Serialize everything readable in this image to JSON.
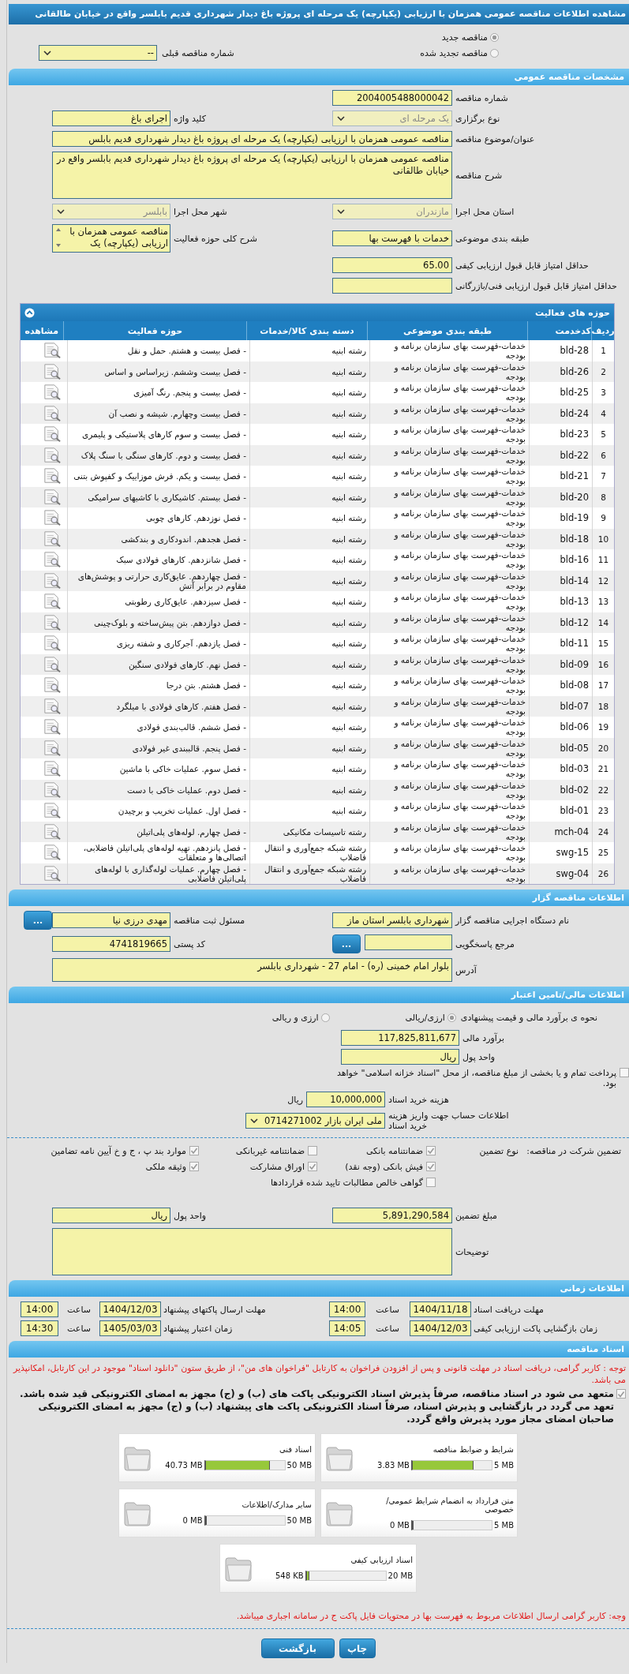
{
  "title": "مشاهده اطلاعات مناقصه عمومی همزمان با ارزیابی (یکپارچه) یک مرحله ای پروژه باغ دیدار شهرداری قدیم بابلسر واقع در خیابان طالقانی",
  "tender_status": [
    {
      "label": "مناقصه جدید",
      "selected": true
    },
    {
      "label": "مناقصه تجدید شده",
      "selected": false
    }
  ],
  "previous_tender": {
    "label": "شماره مناقصه قبلی",
    "value": "--",
    "disabled": false
  },
  "general": {
    "header": "مشخصات مناقصه عمومی",
    "rows": [
      [
        {
          "label": "شماره مناقصه",
          "value": "2004005488000042",
          "kind": "input"
        }
      ],
      [
        {
          "label": "نوع برگزاری",
          "value": "یک مرحله ای",
          "kind": "select",
          "disabled": true
        },
        {
          "label": "کلید واژه",
          "value": "اجرای باغ",
          "kind": "input"
        }
      ],
      [
        {
          "label": "عنوان/موضوع مناقصه",
          "value": "مناقصه عمومی همزمان با ارزیابی (یکپارچه) یک مرحله ای پروژه باغ دیدار شهرداری قدیم بابلس",
          "kind": "wide_input"
        }
      ],
      [
        {
          "label": "شرح مناقصه",
          "value": "مناقصه عمومی همزمان با ارزیابی (یکپارچه) یک مرحله ای پروژه باغ دیدار شهرداری قدیم بابلسر واقع در خیابان طالقانی",
          "kind": "textarea"
        }
      ],
      [
        {
          "label": "استان محل اجرا",
          "value": "مازندران",
          "kind": "select",
          "disabled": true
        },
        {
          "label": "شهر محل اجرا",
          "value": "بابلسر",
          "kind": "select",
          "disabled": true
        }
      ],
      [
        {
          "label": "طبقه بندی موضوعی",
          "value": "خدمات با فهرست بها",
          "kind": "input"
        },
        {
          "label": "شرح کلی حوزه فعالیت",
          "value": "مناقصه عمومی همزمان با ارزیابی (یکپارچه) یک",
          "kind": "listbox"
        }
      ],
      [
        {
          "label": "حداقل امتیاز قابل قبول ارزیابی کیفی",
          "value": "65.00",
          "kind": "input"
        }
      ],
      [
        {
          "label": "حداقل امتیاز قابل قبول ارزیابی فنی/بازرگانی",
          "kind": "input"
        }
      ]
    ]
  },
  "activities": {
    "header": "حوزه های فعالیت",
    "columns": [
      "ردیف",
      "کدخدمت",
      "طبقه بندی موضوعی",
      "دسته بندی کالا/خدمات",
      "حوزه فعالیت",
      "مشاهده"
    ],
    "rows": [
      {
        "index": "1",
        "code": "bld-28",
        "category": "خدمات-فهرست بهای سازمان برنامه و بودجه",
        "group": "رشته ابنیه",
        "activity": "- فصل بیست و هشتم. حمل و نقل"
      },
      {
        "index": "2",
        "code": "bld-26",
        "category": "خدمات-فهرست بهای سازمان برنامه و بودجه",
        "group": "رشته ابنیه",
        "activity": "- فصل بیست وششم. زیراساس و اساس"
      },
      {
        "index": "3",
        "code": "bld-25",
        "category": "خدمات-فهرست بهای سازمان برنامه و بودجه",
        "group": "رشته ابنیه",
        "activity": "- فصل بیست و پنجم. رنگ آمیزی"
      },
      {
        "index": "4",
        "code": "bld-24",
        "category": "خدمات-فهرست بهای سازمان برنامه و بودجه",
        "group": "رشته ابنیه",
        "activity": "- فصل بیست وچهارم. شیشه و نصب آن"
      },
      {
        "index": "5",
        "code": "bld-23",
        "category": "خدمات-فهرست بهای سازمان برنامه و بودجه",
        "group": "رشته ابنیه",
        "activity": "- فصل بیست و سوم کارهای پلاستیکی و پلیمری"
      },
      {
        "index": "6",
        "code": "bld-22",
        "category": "خدمات-فهرست بهای سازمان برنامه و بودجه",
        "group": "رشته ابنیه",
        "activity": "- فصل بیست و دوم. کارهای سنگی با سنگ پلاک"
      },
      {
        "index": "7",
        "code": "bld-21",
        "category": "خدمات-فهرست بهای سازمان برنامه و بودجه",
        "group": "رشته ابنیه",
        "activity": "- فصل بیست و یکم. فرش موزاییک و کفپوش بتنی"
      },
      {
        "index": "8",
        "code": "bld-20",
        "category": "خدمات-فهرست بهای سازمان برنامه و بودجه",
        "group": "رشته ابنیه",
        "activity": "- فصل بیستم. کاشیکاری با کاشیهای سرامیکی"
      },
      {
        "index": "9",
        "code": "bld-19",
        "category": "خدمات-فهرست بهای سازمان برنامه و بودجه",
        "group": "رشته ابنیه",
        "activity": "- فصل نوزدهم. کارهای چوبی"
      },
      {
        "index": "10",
        "code": "bld-18",
        "category": "خدمات-فهرست بهای سازمان برنامه و بودجه",
        "group": "رشته ابنیه",
        "activity": "- فصل هجدهم. اندودکاری و بندکشی"
      },
      {
        "index": "11",
        "code": "bld-16",
        "category": "خدمات-فهرست بهای سازمان برنامه و بودجه",
        "group": "رشته ابنیه",
        "activity": "- فصل شانزدهم. کارهای فولادی سبک"
      },
      {
        "index": "12",
        "code": "bld-14",
        "category": "خدمات-فهرست بهای سازمان برنامه و بودجه",
        "group": "رشته ابنیه",
        "activity": "- فصل چهاردهم. عایق‌کاری حرارتی و پوشش‌های مقاوم در برابر آتش"
      },
      {
        "index": "13",
        "code": "bld-13",
        "category": "خدمات-فهرست بهای سازمان برنامه و بودجه",
        "group": "رشته ابنیه",
        "activity": "- فصل سیزدهم. عایق‌کاری رطوبتی"
      },
      {
        "index": "14",
        "code": "bld-12",
        "category": "خدمات-فهرست بهای سازمان برنامه و بودجه",
        "group": "رشته ابنیه",
        "activity": "- فصل دوازدهم. بتن پیش‌ساخته و بلوک‌چینی"
      },
      {
        "index": "15",
        "code": "bld-11",
        "category": "خدمات-فهرست بهای سازمان برنامه و بودجه",
        "group": "رشته ابنیه",
        "activity": "- فصل یازدهم. آجرکاری و شفته ریزی"
      },
      {
        "index": "16",
        "code": "bld-09",
        "category": "خدمات-فهرست بهای سازمان برنامه و بودجه",
        "group": "رشته ابنیه",
        "activity": "- فصل نهم. کارهای فولادی سنگین"
      },
      {
        "index": "17",
        "code": "bld-08",
        "category": "خدمات-فهرست بهای سازمان برنامه و بودجه",
        "group": "رشته ابنیه",
        "activity": "- فصل هشتم. بتن درجا"
      },
      {
        "index": "18",
        "code": "bld-07",
        "category": "خدمات-فهرست بهای سازمان برنامه و بودجه",
        "group": "رشته ابنیه",
        "activity": "- فصل هفتم. کارهای فولادی با میلگرد"
      },
      {
        "index": "19",
        "code": "bld-06",
        "category": "خدمات-فهرست بهای سازمان برنامه و بودجه",
        "group": "رشته ابنیه",
        "activity": "- فصل ششم. قالب‌بندی فولادی"
      },
      {
        "index": "20",
        "code": "bld-05",
        "category": "خدمات-فهرست بهای سازمان برنامه و بودجه",
        "group": "رشته ابنیه",
        "activity": "- فصل پنجم. قالببندی غیر فولادی"
      },
      {
        "index": "21",
        "code": "bld-03",
        "category": "خدمات-فهرست بهای سازمان برنامه و بودجه",
        "group": "رشته ابنیه",
        "activity": "- فصل سوم. عملیات خاکی با ماشین"
      },
      {
        "index": "22",
        "code": "bld-02",
        "category": "خدمات-فهرست بهای سازمان برنامه و بودجه",
        "group": "رشته ابنیه",
        "activity": "- فصل دوم. عملیات خاکی با دست"
      },
      {
        "index": "23",
        "code": "bld-01",
        "category": "خدمات-فهرست بهای سازمان برنامه و بودجه",
        "group": "رشته ابنیه",
        "activity": "- فصل اول. عملیات تخریب و برچیدن"
      },
      {
        "index": "24",
        "code": "mch-04",
        "category": "خدمات-فهرست بهای سازمان برنامه و بودجه",
        "group": "رشته تاسیسات مکانیکی",
        "activity": "- فصل چهارم. لوله‌های پلی‌اتیلن"
      },
      {
        "index": "25",
        "code": "swg-15",
        "category": "خدمات-فهرست بهای سازمان برنامه و بودجه",
        "group": "رشته شبکه جمع‌آوری و انتقال فاضلاب",
        "activity": "- فصل پانزدهم. تهیه لوله‌های پلی‌اتیلن فاضلابی، اتصالی‌ها و متعلقات"
      },
      {
        "index": "26",
        "code": "swg-04",
        "category": "خدمات-فهرست بهای سازمان برنامه و بودجه",
        "group": "رشته شبکه جمع‌آوری و انتقال فاضلاب",
        "activity": "- فصل چهارم. عملیات لوله‌گذاری با لوله‌های پلی‌اتیلن فاضلابی"
      }
    ]
  },
  "tenderer": {
    "header": "اطلاعات مناقصه گزار",
    "rows": [
      [
        {
          "label": "نام دستگاه اجرایی مناقصه گزار",
          "value": "شهرداری بابلسر استان ماز",
          "kind": "input"
        },
        {
          "label": "مسئول ثبت مناقصه",
          "value": "مهدی درزی نیا",
          "kind": "input",
          "button": "..."
        }
      ],
      [
        {
          "label": "مرجع پاسخگویی",
          "kind": "input",
          "button": "..."
        },
        {
          "label": "کد پستی",
          "value": "4741819665",
          "kind": "input"
        }
      ],
      [
        {
          "label": "آدرس",
          "value": "بلوار امام خمینی (ره) - امام 27 - شهرداری بابلسر",
          "kind": "textarea"
        }
      ]
    ]
  },
  "finance": {
    "header": "اطلاعات مالی/تامین اعتبار",
    "estimate_method": {
      "label": "نحوه ی برآورد مالی و قیمت پیشنهادی",
      "options": [
        {
          "label": "ارزی/ریالی",
          "selected": true
        },
        {
          "label": "ارزی و ریالی",
          "selected": false
        }
      ]
    },
    "estimate": {
      "label": "برآورد مالی",
      "value": "117,825,811,677"
    },
    "currency": {
      "label": "واحد پول",
      "value": "ریال"
    },
    "treasury": {
      "label": "پرداخت تمام و یا بخشی از مبلغ مناقصه، از محل \"اسناد خزانه اسلامی\" خواهد بود.",
      "checked": false
    },
    "document_fee": {
      "label": "هزینه خرید اسناد",
      "value": "10,000,000",
      "unit": "ریال"
    },
    "account": {
      "label": "اطلاعات حساب جهت واریز هزینه خرید اسناد",
      "value": "ملی ایران بازار 0714271002"
    }
  },
  "guarantee": {
    "label": "تضمین شرکت در مناقصه:",
    "type_label": "نوع تضمین",
    "options": [
      {
        "label": "ضمانتنامه بانکی",
        "checked": true
      },
      {
        "label": "ضمانتنامه غیربانکی",
        "checked": false
      },
      {
        "label": "موارد بند پ ، ج و خ آیین نامه تضامین",
        "checked": true
      },
      {
        "label": "فیش بانکی (وجه نقد)",
        "checked": true
      },
      {
        "label": "اوراق مشارکت",
        "checked": true
      },
      {
        "label": "وثیقه ملکی",
        "checked": true
      },
      {
        "label": "گواهی خالص مطالبات تایید شده قراردادها",
        "checked": false
      }
    ],
    "amount": {
      "label": "مبلغ تضمین",
      "value": "5,891,290,584"
    },
    "currency": {
      "label": "واحد پول",
      "value": "ریال"
    },
    "notes": {
      "label": "توضیحات"
    }
  },
  "timing": {
    "header": "اطلاعات زمانی",
    "items": [
      {
        "label": "مهلت دریافت اسناد",
        "date": "1404/11/18",
        "time_label": "ساعت",
        "time": "14:00"
      },
      {
        "label": "مهلت ارسال پاکتهای پیشنهاد",
        "date": "1404/12/03",
        "time_label": "ساعت",
        "time": "14:00"
      },
      {
        "label": "زمان بازگشایی پاکت ارزیابی کیفی",
        "date": "1404/12/03",
        "time_label": "ساعت",
        "time": "14:05"
      },
      {
        "label": "زمان اعتبار پیشنهاد",
        "date": "1405/03/03",
        "time_label": "ساعت",
        "time": "14:30"
      }
    ]
  },
  "documents": {
    "header": "اسناد مناقصه",
    "notice": "توجه : کاربر گرامی، دریافت اسناد در مهلت قانونی و پس از افزودن فراخوان به کارتابل \"فراخوان های من\"، از طریق ستون \"دانلود اسناد\" موجود در این کارتابل، امکانپذیر می باشد.",
    "commitment": {
      "text": "متعهد می شود در اسناد مناقصه، صرفاً پذیرش اسناد الکترونیکی پاکت های (ب) و (ج) مجهز به امضای الکترونیکی قید شده باشد. تعهد می گردد در بازگشایی و پذیرش اسناد، صرفاً اسناد الکترونیکی پاکت های پیشنهاد (ب) و (ج) مجهز به امضای الکترونیکی صاحبان امضای مجاز مورد پذیرش واقع گردد.",
      "checked": true
    },
    "files": [
      {
        "name": "شرایط و ضوابط مناقصه",
        "used": "3.83 MB",
        "max": "5 MB",
        "level": 0.77
      },
      {
        "name": "اسناد فنی",
        "used": "40.73 MB",
        "max": "50 MB",
        "level": 0.81
      },
      {
        "name": "متن قرارداد به انضمام شرایط عمومی/خصوصی",
        "used": "0 MB",
        "max": "5 MB",
        "level": 0
      },
      {
        "name": "سایر مدارک/اطلاعات",
        "used": "0 MB",
        "max": "50 MB",
        "level": 0
      },
      {
        "name": "اسناد ارزیابی کیفی",
        "used": "548 KB",
        "max": "20 MB",
        "level": 0.03
      }
    ],
    "footer_notice": "وجه: کاربر گرامی ارسال اطلاعات مربوط به فهرست بها در محتویات فایل پاکت ج در سامانه اجباری میباشد."
  },
  "buttons": [
    {
      "label": "چاپ"
    },
    {
      "label": "بازگشت"
    }
  ]
}
